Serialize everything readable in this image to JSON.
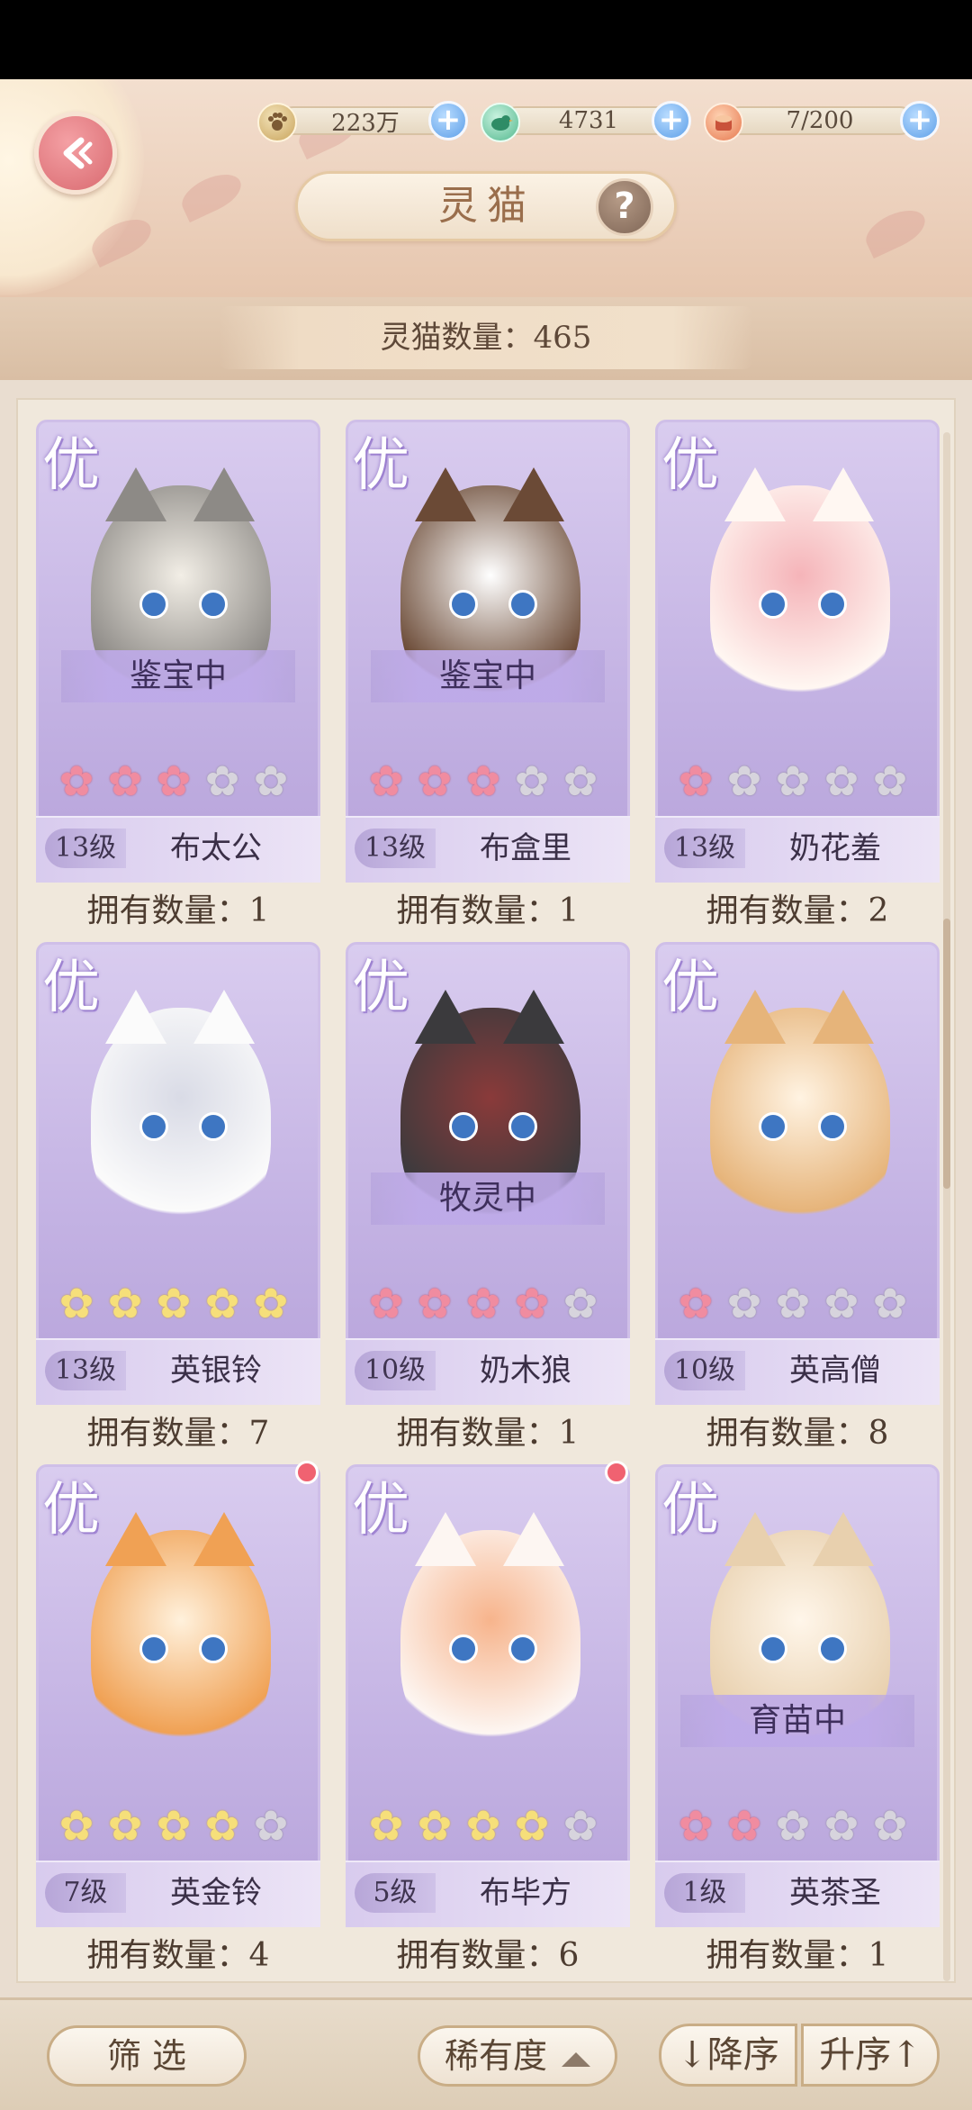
{
  "header": {
    "title": "灵猫",
    "resources": [
      {
        "icon": "paw-coin-icon",
        "value": "223万"
      },
      {
        "icon": "jade-bird-icon",
        "value": "4731"
      },
      {
        "icon": "fish-can-icon",
        "value": "7/200"
      }
    ]
  },
  "count_label": "灵猫数量：465",
  "grade_label": "优",
  "cards": [
    {
      "status": "鉴宝中",
      "level": "13级",
      "name": "布太公",
      "stars": [
        "pink",
        "pink",
        "pink",
        "gray",
        "gray"
      ],
      "owned": "拥有数量：1",
      "new_dot": false
    },
    {
      "status": "鉴宝中",
      "level": "13级",
      "name": "布盒里",
      "stars": [
        "pink",
        "pink",
        "pink",
        "gray",
        "gray"
      ],
      "owned": "拥有数量：1",
      "new_dot": false
    },
    {
      "status": "",
      "level": "13级",
      "name": "奶花羞",
      "stars": [
        "pink",
        "gray",
        "gray",
        "gray",
        "gray"
      ],
      "owned": "拥有数量：2",
      "new_dot": false
    },
    {
      "status": "",
      "level": "13级",
      "name": "英银铃",
      "stars": [
        "gold",
        "gold",
        "gold",
        "gold",
        "gold"
      ],
      "owned": "拥有数量：7",
      "new_dot": false
    },
    {
      "status": "牧灵中",
      "level": "10级",
      "name": "奶木狼",
      "stars": [
        "pink",
        "pink",
        "pink",
        "pink",
        "gray"
      ],
      "owned": "拥有数量：1",
      "new_dot": false
    },
    {
      "status": "",
      "level": "10级",
      "name": "英高僧",
      "stars": [
        "pink",
        "gray",
        "gray",
        "gray",
        "gray"
      ],
      "owned": "拥有数量：8",
      "new_dot": false
    },
    {
      "status": "",
      "level": "7级",
      "name": "英金铃",
      "stars": [
        "gold",
        "gold",
        "gold",
        "gold",
        "gray"
      ],
      "owned": "拥有数量：4",
      "new_dot": true
    },
    {
      "status": "",
      "level": "5级",
      "name": "布毕方",
      "stars": [
        "gold",
        "gold",
        "gold",
        "gold",
        "gray"
      ],
      "owned": "拥有数量：6",
      "new_dot": true
    },
    {
      "status": "育苗中",
      "level": "1级",
      "name": "英茶圣",
      "stars": [
        "pink",
        "pink",
        "gray",
        "gray",
        "gray"
      ],
      "owned": "拥有数量：1",
      "new_dot": false
    }
  ],
  "bottom": {
    "filter": "筛 选",
    "sort_field": "稀有度",
    "desc": "↓降序",
    "asc": "升序↑"
  },
  "colors": {
    "pink_star": "#f08ca0",
    "gold_star": "#f6df7a",
    "gray_star": "#d7d4dd",
    "card_bg": "#c3b2e3"
  }
}
